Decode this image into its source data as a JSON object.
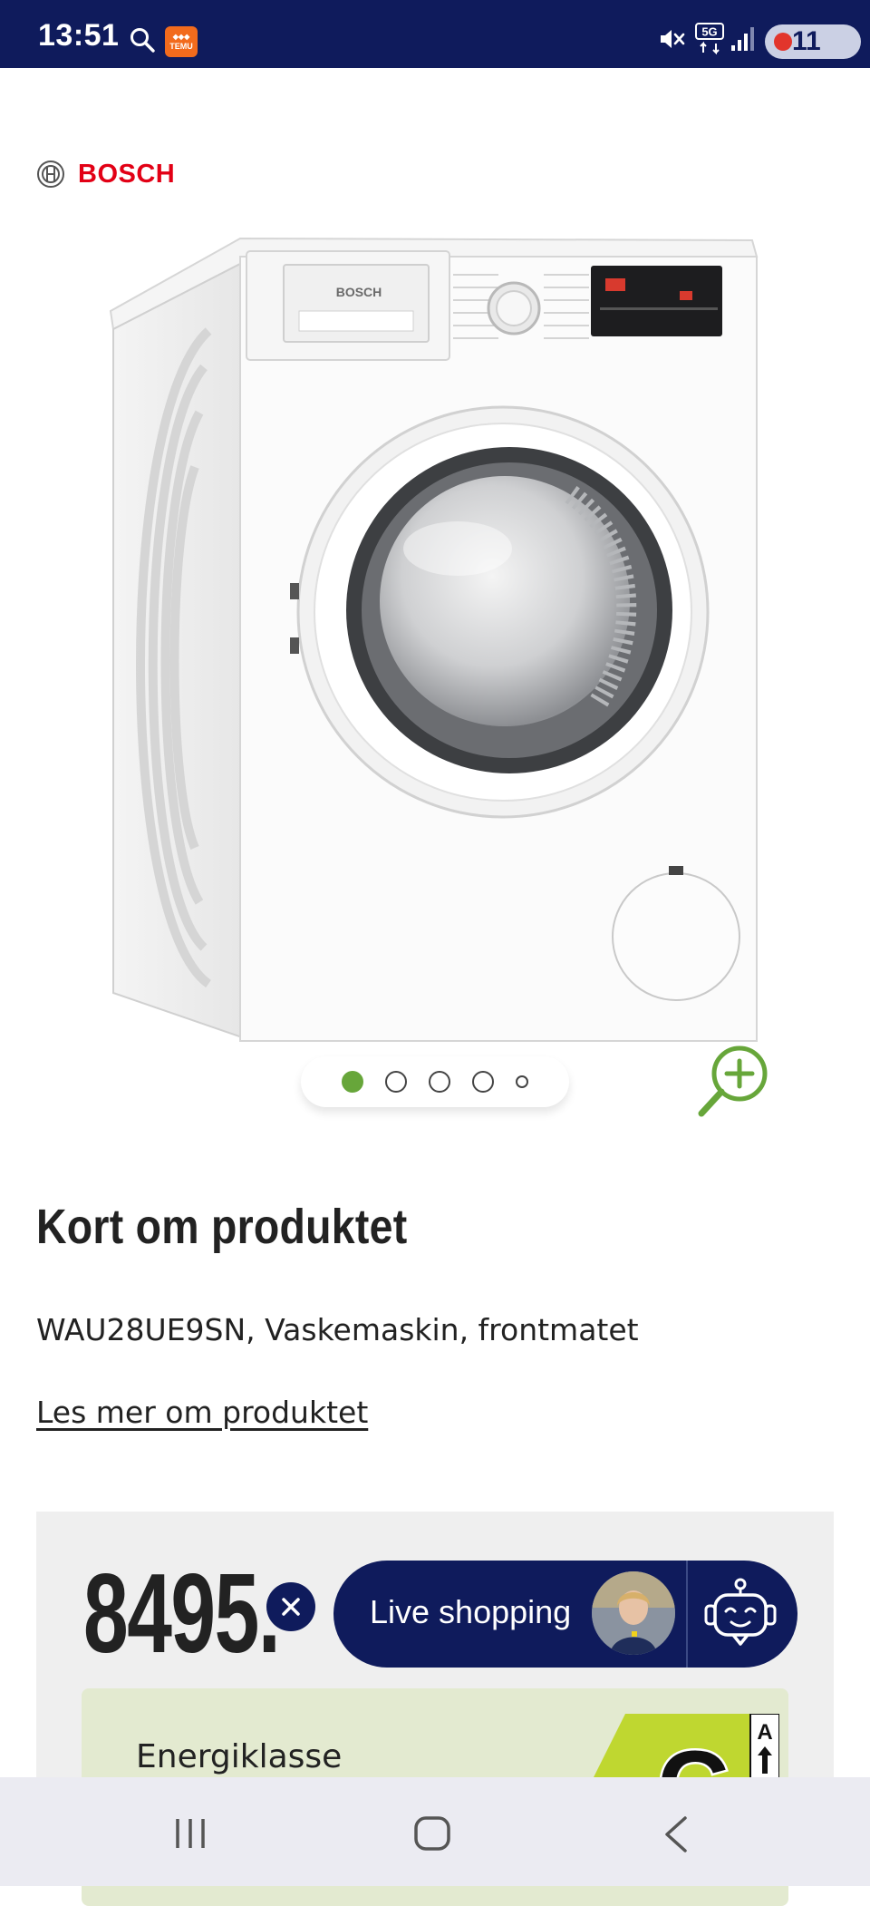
{
  "status_bar": {
    "time": "13:51",
    "temu_label": "TEMU",
    "network": "5G",
    "battery": "11",
    "icons": [
      "search-icon",
      "temu-app-icon",
      "mute-icon",
      "5g-icon",
      "signal-icon",
      "battery-icon"
    ]
  },
  "brand": {
    "name": "BOSCH",
    "color": "#e20015"
  },
  "product_image": {
    "alt": "Bosch vaskemaskin",
    "carousel": {
      "total": 5,
      "active": 1
    }
  },
  "summary": {
    "heading": "Kort om produktet",
    "description": "WAU28UE9SN, Vaskemaskin, frontmatet",
    "read_more": "Les mer om produktet"
  },
  "price": {
    "value": "8495."
  },
  "energy": {
    "label": "Energiklasse",
    "class": "C",
    "scale_top": "A"
  },
  "live_shopping": {
    "label": "Live shopping",
    "close": "×"
  },
  "colors": {
    "navy": "#0f1b5c",
    "accent_green": "#67a63a",
    "bosch_red": "#e20015",
    "energy_yellow_green": "#bfd730"
  },
  "nav_bar": {
    "icons": [
      "recents-icon",
      "home-icon",
      "back-icon"
    ]
  }
}
